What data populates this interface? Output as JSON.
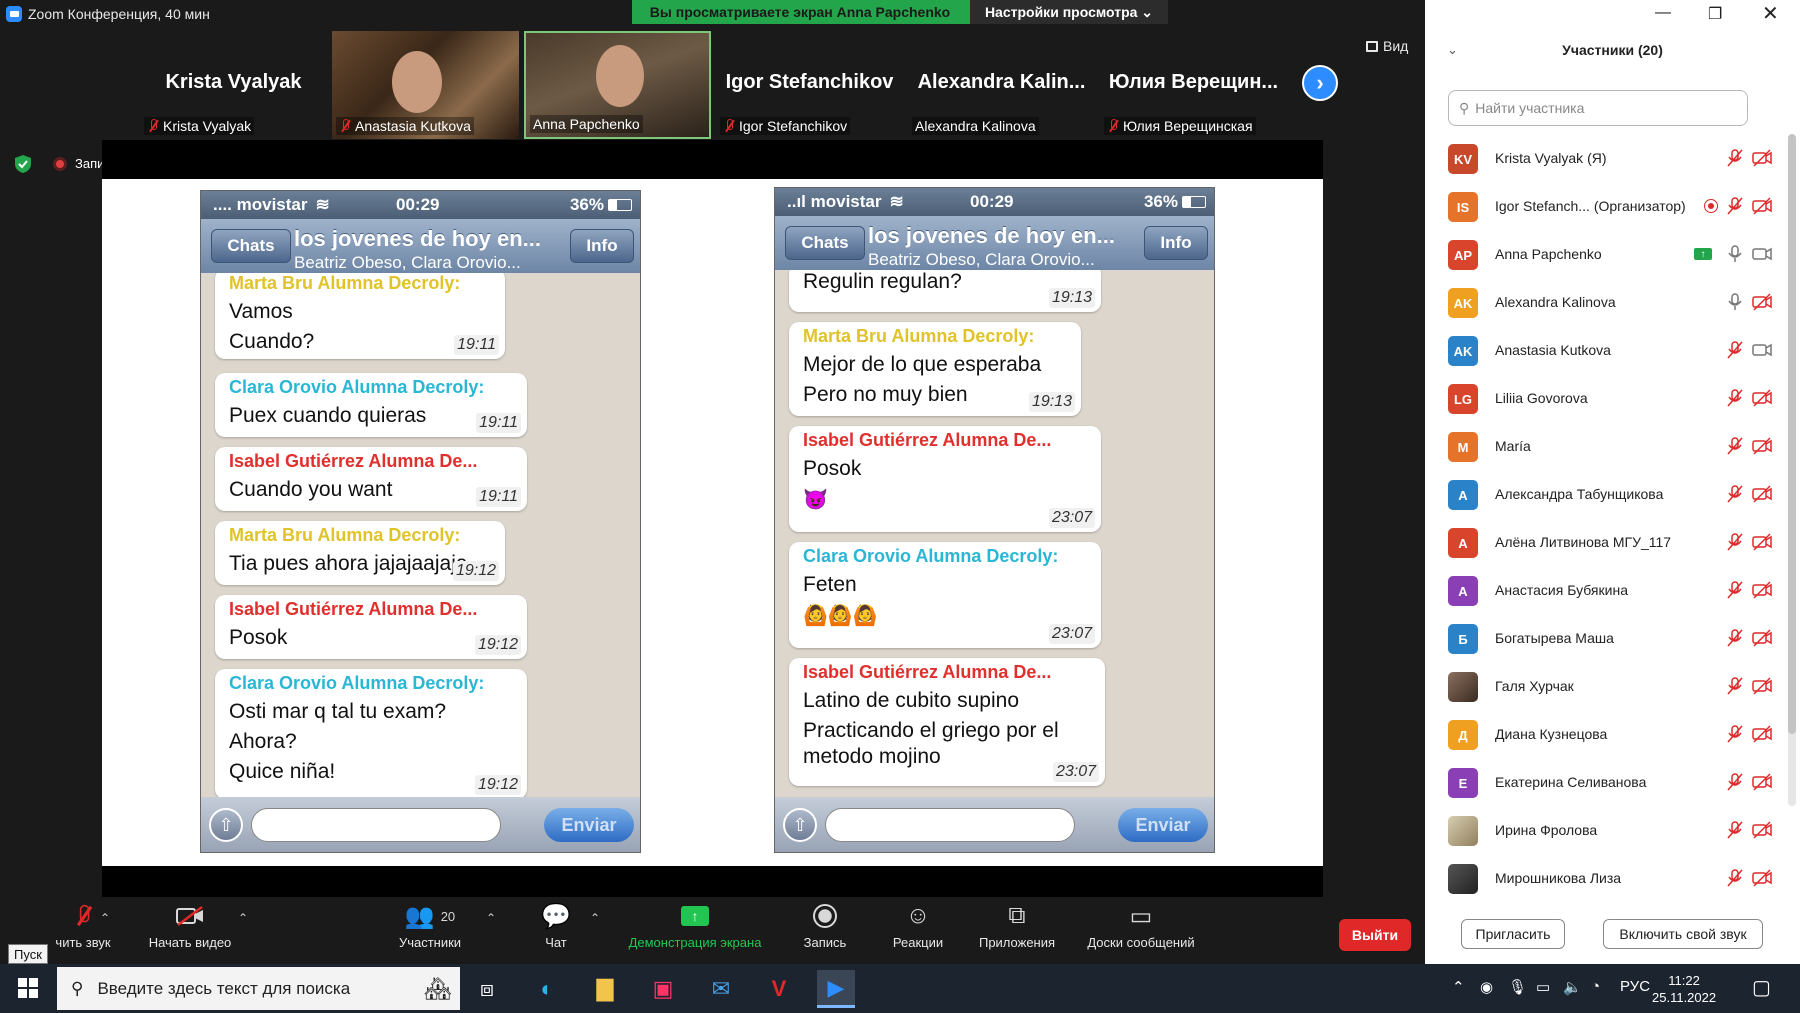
{
  "window": {
    "title": "Zoom Конференция, 40 мин"
  },
  "banner": {
    "viewing": "Вы просматриваете экран Anna Papchenko",
    "view_settings": "Настройки просмотра ⌄"
  },
  "gallery": [
    {
      "big": "Krista Vyalyak",
      "caption": "Krista Vyalyak",
      "muted": true
    },
    {
      "big": "",
      "caption": "Anastasia Kutkova",
      "muted": true
    },
    {
      "big": "",
      "caption": "Anna Papchenko",
      "muted": false
    },
    {
      "big": "Igor Stefanchikov",
      "caption": "Igor Stefanchikov",
      "muted": true
    },
    {
      "big": "Alexandra Kalin...",
      "caption": "Alexandra Kalinova",
      "muted": false
    },
    {
      "big": "Юлия Верещин...",
      "caption": "Юлия Верещинская",
      "muted": true
    }
  ],
  "view_button": "Вид",
  "recording_label": "Запись",
  "phone_left": {
    "carrier": ".... movistar",
    "time": "00:29",
    "battery": "36%",
    "back": "Chats",
    "title": "los jovenes de hoy en...",
    "subtitle": "Beatriz Obeso, Clara Orovio...",
    "info": "Info",
    "send": "Enviar",
    "messages": [
      {
        "who": "Marta Bru Alumna Decroly:",
        "lines": [
          "Vamos",
          "Cuando?"
        ],
        "time": "19:11"
      },
      {
        "who": "Clara Orovio Alumna Decroly:",
        "lines": [
          "Puex cuando quieras"
        ],
        "time": "19:11"
      },
      {
        "who": "Isabel Gutiérrez Alumna De...",
        "lines": [
          "Cuando you want"
        ],
        "time": "19:11"
      },
      {
        "who": "Marta Bru Alumna Decroly:",
        "lines": [
          "Tia pues ahora jajajaajaja"
        ],
        "time": "19:12"
      },
      {
        "who": "Isabel Gutiérrez Alumna De...",
        "lines": [
          "Posok"
        ],
        "time": "19:12"
      },
      {
        "who": "Clara Orovio Alumna Decroly:",
        "lines": [
          "Osti mar q tal tu exam?",
          "Ahora?",
          "Quice niña!"
        ],
        "time": "19:12"
      }
    ]
  },
  "phone_right": {
    "carrier": "..ıl movistar",
    "time": "00:29",
    "battery": "36%",
    "back": "Chats",
    "title": "los jovenes de hoy en...",
    "subtitle": "Beatriz Obeso, Clara Orovio...",
    "info": "Info",
    "send": "Enviar",
    "messages": [
      {
        "who": "",
        "lines": [
          "Regulin regulan?"
        ],
        "time": "19:13"
      },
      {
        "who": "Marta Bru Alumna Decroly:",
        "lines": [
          "Mejor de lo que esperaba",
          "Pero no muy bien"
        ],
        "time": "19:13"
      },
      {
        "who": "Isabel Gutiérrez Alumna De...",
        "lines": [
          "Posok",
          "😈"
        ],
        "time": "23:07"
      },
      {
        "who": "Clara Orovio Alumna Decroly:",
        "lines": [
          "Feten",
          "🙆🙆🙆"
        ],
        "time": "23:07"
      },
      {
        "who": "Isabel Gutiérrez Alumna De...",
        "lines": [
          "Latino de cubito supino",
          "Practicando el griego por el",
          "metodo mojino"
        ],
        "time": "23:07"
      }
    ]
  },
  "toolbar": {
    "unmute": "чить звук",
    "start_video": "Начать видео",
    "participants": "Участники",
    "participants_count": "20",
    "chat": "Чат",
    "share": "Демонстрация экрана",
    "record": "Запись",
    "reactions": "Реакции",
    "apps": "Приложения",
    "whiteboards": "Доски сообщений",
    "leave": "Выйти",
    "start_tooltip": "Пуск"
  },
  "panel": {
    "title": "Участники (20)",
    "search_placeholder": "Найти участника",
    "invite": "Пригласить",
    "unmute_me": "Включить свой звук",
    "participants": [
      {
        "initials": "KV",
        "name": "Krista Vyalyak (Я)",
        "color": "#c7482b"
      },
      {
        "initials": "IS",
        "name": "Igor Stefanch... (Организатор)",
        "color": "#e5742a"
      },
      {
        "initials": "AP",
        "name": "Anna Papchenko",
        "color": "#d8452c"
      },
      {
        "initials": "AK",
        "name": "Alexandra Kalinova",
        "color": "#f0a020"
      },
      {
        "initials": "AK",
        "name": "Anastasia Kutkova",
        "color": "#2a82c9"
      },
      {
        "initials": "LG",
        "name": "Liliia Govorova",
        "color": "#d8452c"
      },
      {
        "initials": "M",
        "name": "María",
        "color": "#e5742a"
      },
      {
        "initials": "A",
        "name": "Александра Табунщикова",
        "color": "#2a82c9"
      },
      {
        "initials": "A",
        "name": "Алёна Литвинова МГУ_117",
        "color": "#d8452c"
      },
      {
        "initials": "A",
        "name": "Анастасия Бубякина",
        "color": "#8b3fb5"
      },
      {
        "initials": "Б",
        "name": "Богатырева Маша",
        "color": "#2a82c9"
      },
      {
        "initials": "",
        "name": "Галя Хурчак",
        "color": "#6b5548"
      },
      {
        "initials": "Д",
        "name": "Диана Кузнецова",
        "color": "#f0a020"
      },
      {
        "initials": "E",
        "name": "Екатерина Селиванова",
        "color": "#8b3fb5"
      },
      {
        "initials": "",
        "name": "Ирина Фролова",
        "color": "#b9a98a"
      },
      {
        "initials": "",
        "name": "Мирошникова Лиза",
        "color": "#3a3a3a"
      }
    ]
  },
  "taskbar": {
    "search_placeholder": "Введите здесь текст для поиска",
    "lang": "РУС",
    "time": "11:22",
    "date": "25.11.2022"
  }
}
